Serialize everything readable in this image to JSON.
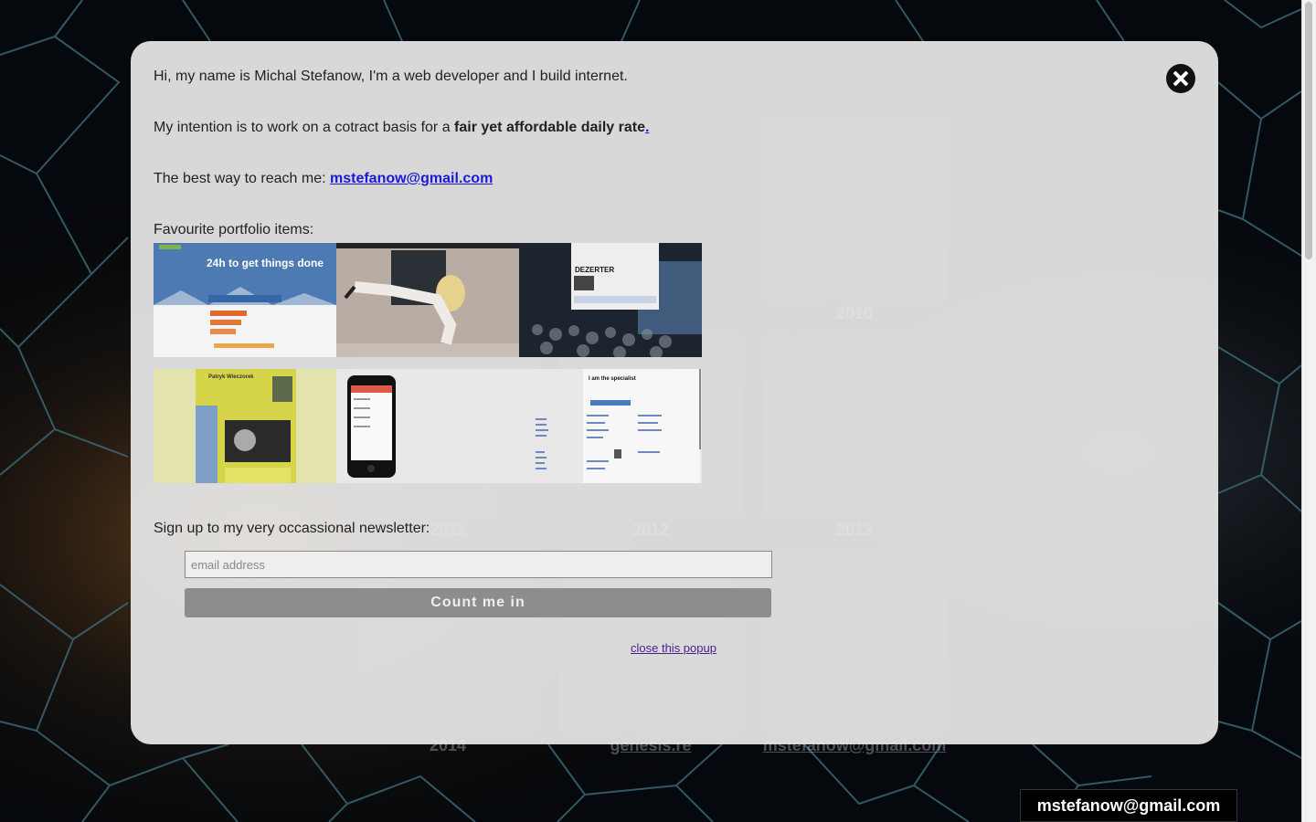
{
  "background": {
    "tiles": [
      {
        "label": "2010"
      },
      {
        "label": "2011"
      },
      {
        "label": "2012"
      },
      {
        "label": "2013"
      },
      {
        "label": "2014"
      },
      {
        "label": "genesis.re"
      },
      {
        "label": "mstefanow@gmail.com"
      }
    ]
  },
  "popup": {
    "intro": "Hi, my name is Michal Stefanow, I'm a web developer and I build internet.",
    "rate_prefix": "My intention is to work on a cotract basis for a ",
    "rate_bold": "fair yet affordable daily rate",
    "rate_link": ".",
    "contact_prefix": "The best way to reach me: ",
    "contact_email": "mstefanow@gmail.com",
    "portfolio_heading": "Favourite portfolio items:",
    "portfolio": [
      {
        "title": "24h to get things done"
      },
      {
        "title": "plank photo"
      },
      {
        "title": "DEZERTER"
      },
      {
        "title": "Patryk Wieczorek"
      },
      {
        "title": "mobile app"
      },
      {
        "title": "I am the specialist"
      }
    ],
    "newsletter_heading": "Sign up to my very occassional newsletter:",
    "email_placeholder": "email address",
    "submit_label": "Count me in",
    "close_link": "close this popup"
  },
  "badge": {
    "email": "mstefanow@gmail.com"
  },
  "colors": {
    "link": "#1a1ad8",
    "visited_link": "#4b1d8a",
    "popup_bg": "#e8e8e8"
  }
}
